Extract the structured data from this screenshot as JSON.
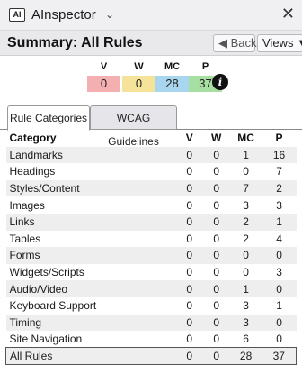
{
  "window": {
    "app_badge": "AI",
    "app_title": "AInspector",
    "close_symbol": "✕"
  },
  "header": {
    "title": "Summary: All Rules",
    "back_label": "◀ Back",
    "views_label": "Views ▼"
  },
  "summary": {
    "labels": {
      "v": "V",
      "w": "W",
      "mc": "MC",
      "p": "P"
    },
    "values": {
      "v": "0",
      "w": "0",
      "mc": "28",
      "p": "37"
    },
    "colors": {
      "v": "#f4b0b0",
      "w": "#f6e39a",
      "mc": "#a9d6ef",
      "p": "#a7dea1"
    },
    "info_symbol": "i"
  },
  "tabs": [
    {
      "label": "Rule Categories",
      "active": true
    },
    {
      "label": "WCAG Guidelines",
      "active": false
    }
  ],
  "table": {
    "headers": [
      "Category",
      "V",
      "W",
      "MC",
      "P"
    ],
    "rows": [
      [
        "Landmarks",
        "0",
        "0",
        "1",
        "16"
      ],
      [
        "Headings",
        "0",
        "0",
        "0",
        "7"
      ],
      [
        "Styles/Content",
        "0",
        "0",
        "7",
        "2"
      ],
      [
        "Images",
        "0",
        "0",
        "3",
        "3"
      ],
      [
        "Links",
        "0",
        "0",
        "2",
        "1"
      ],
      [
        "Tables",
        "0",
        "0",
        "2",
        "4"
      ],
      [
        "Forms",
        "0",
        "0",
        "0",
        "0"
      ],
      [
        "Widgets/Scripts",
        "0",
        "0",
        "0",
        "3"
      ],
      [
        "Audio/Video",
        "0",
        "0",
        "1",
        "0"
      ],
      [
        "Keyboard Support",
        "0",
        "0",
        "3",
        "1"
      ],
      [
        "Timing",
        "0",
        "0",
        "3",
        "0"
      ],
      [
        "Site Navigation",
        "0",
        "0",
        "6",
        "0"
      ]
    ],
    "total": [
      "All Rules",
      "0",
      "0",
      "28",
      "37"
    ]
  }
}
